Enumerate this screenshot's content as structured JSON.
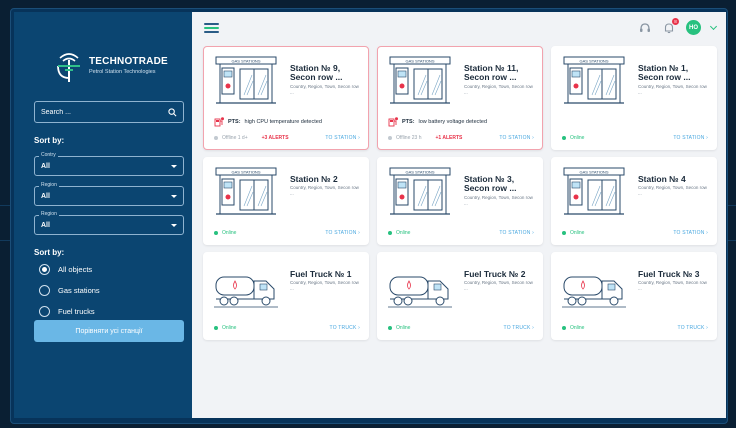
{
  "brand": {
    "name": "TECHNOTRADE",
    "tagline": "Petrol Station Technologies"
  },
  "search": {
    "placeholder": "Search ..."
  },
  "filters": {
    "sort_label": "Sort by:",
    "selects": [
      {
        "legend": "Contry",
        "value": "All"
      },
      {
        "legend": "Region",
        "value": "All"
      },
      {
        "legend": "Region",
        "value": "All"
      }
    ],
    "type_label": "Sort by:",
    "types": [
      {
        "label": "All objects",
        "selected": true
      },
      {
        "label": "Gas stations",
        "selected": false
      },
      {
        "label": "Fuel trucks",
        "selected": false
      }
    ],
    "compare_button": "Порівняти усі станції"
  },
  "header": {
    "menu_icon": "hamburger-menu-icon",
    "notifications_badge": "8",
    "user_initials": "HO"
  },
  "colors": {
    "sidebar": "#0b4571",
    "accent": "#4aa8e0",
    "online": "#27c17f",
    "alert": "#e8334a"
  },
  "cards": [
    {
      "kind": "station",
      "title": "Station № 9, Secon row ...",
      "address": "Country, Region, Town, Secon row ...",
      "alert": true,
      "warning_label": "PTS:",
      "warning_text": "high CPU temperature detected",
      "status": "Offline 1 d+",
      "status_kind": "off",
      "alerts": "+3 ALERTS",
      "link": "TO STATION"
    },
    {
      "kind": "station",
      "title": "Station № 11, Secon row ...",
      "address": "Country, Region, Town, Secon row ...",
      "alert": true,
      "warning_label": "PTS:",
      "warning_text": "low battery voltage detected",
      "status": "Offline 23 h",
      "status_kind": "off",
      "alerts": "+1 ALERTS",
      "link": "TO STATION"
    },
    {
      "kind": "station",
      "title": "Station № 1, Secon row ...",
      "address": "Country, Region, Town, Secon row ...",
      "alert": false,
      "status": "Online",
      "status_kind": "on",
      "link": "TO STATION"
    },
    {
      "kind": "station",
      "title": "Station № 2",
      "address": "Country, Region, Town, Secon row ...",
      "alert": false,
      "status": "Online",
      "status_kind": "on",
      "link": "TO STATION"
    },
    {
      "kind": "station",
      "title": "Station № 3, Secon row ...",
      "address": "Country, Region, Town, Secon row ...",
      "alert": false,
      "status": "Online",
      "status_kind": "on",
      "link": "TO STATION"
    },
    {
      "kind": "station",
      "title": "Station № 4",
      "address": "Country, Region, Town, Secon row ...",
      "alert": false,
      "status": "Online",
      "status_kind": "on",
      "link": "TO STATION"
    },
    {
      "kind": "truck",
      "title": "Fuel Truck № 1",
      "address": "Country, Region, Town, Secon row ...",
      "alert": false,
      "status": "Online",
      "status_kind": "on",
      "link": "TO TRUCK"
    },
    {
      "kind": "truck",
      "title": "Fuel Truck № 2",
      "address": "Country, Region, Town, Secon row ...",
      "alert": false,
      "status": "Online",
      "status_kind": "on",
      "link": "TO TRUCK"
    },
    {
      "kind": "truck",
      "title": "Fuel Truck № 3",
      "address": "Country, Region, Town, Secon row ...",
      "alert": false,
      "status": "Online",
      "status_kind": "on",
      "link": "TO TRUCK"
    }
  ],
  "illustration": {
    "station_sign": "GAS STATIONS"
  }
}
